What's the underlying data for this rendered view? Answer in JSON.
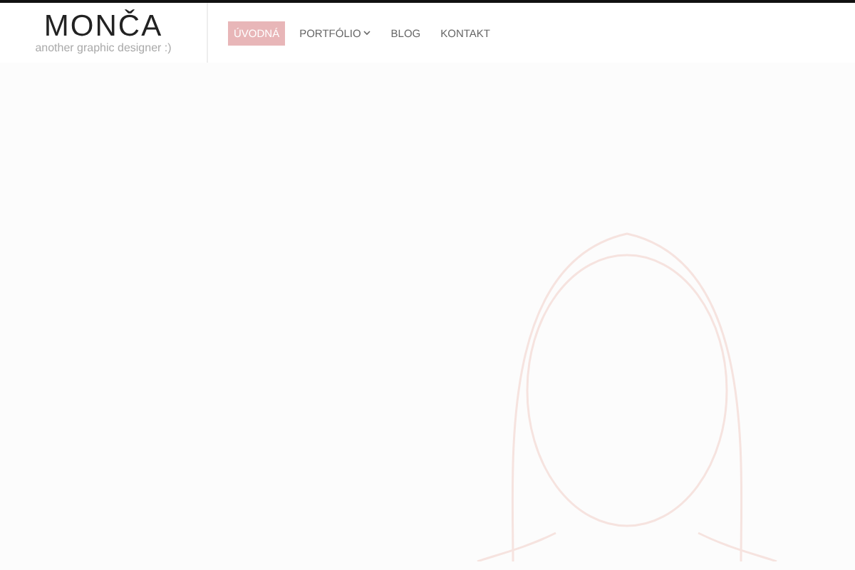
{
  "logo": {
    "title": "MONČA",
    "tagline": "another graphic designer :)"
  },
  "nav": [
    {
      "label": "ÚVODNÁ",
      "selected": true,
      "dropdown": false
    },
    {
      "label": "PORTFÓLIO",
      "selected": false,
      "dropdown": true
    },
    {
      "label": "BLOG",
      "selected": false,
      "dropdown": false
    },
    {
      "label": "KONTAKT",
      "selected": false,
      "dropdown": false
    }
  ]
}
